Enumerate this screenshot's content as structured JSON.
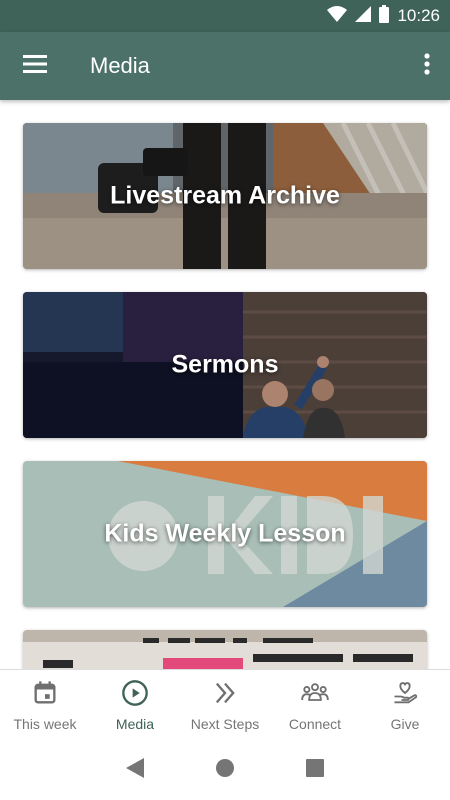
{
  "status_bar": {
    "time": "10:26",
    "icons": [
      "wifi-icon",
      "cell-signal-icon",
      "battery-icon"
    ]
  },
  "app_bar": {
    "title": "Media",
    "menu_icon": "hamburger-menu-icon",
    "more_icon": "more-vert-icon",
    "background": "#4b7169"
  },
  "cards": [
    {
      "label": "Livestream Archive"
    },
    {
      "label": "Sermons"
    },
    {
      "label": "Kids Weekly Lesson"
    },
    {
      "label": ""
    }
  ],
  "bottom_nav": {
    "items": [
      {
        "label": "This week",
        "icon": "calendar-icon",
        "active": false
      },
      {
        "label": "Media",
        "icon": "play-circle-icon",
        "active": true
      },
      {
        "label": "Next Steps",
        "icon": "double-chevron-right-icon",
        "active": false
      },
      {
        "label": "Connect",
        "icon": "people-group-icon",
        "active": false
      },
      {
        "label": "Give",
        "icon": "hand-heart-icon",
        "active": false
      }
    ],
    "active_color": "#3f6259",
    "inactive_color": "#757575"
  },
  "system_nav": {
    "icons": [
      "back-triangle-icon",
      "home-circle-icon",
      "recents-square-icon"
    ]
  }
}
